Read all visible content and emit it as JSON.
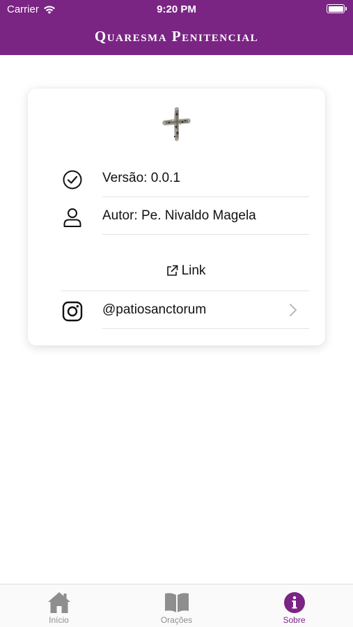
{
  "status_bar": {
    "carrier": "Carrier",
    "time": "9:20 PM"
  },
  "header": {
    "title": "Quaresma Penitencial"
  },
  "card": {
    "logo_icon": "ash-cross-logo",
    "version_text": "Versão: 0.0.1",
    "version_icon": "check-circle-icon",
    "author_text": "Autor: Pe. Nivaldo Magela",
    "author_icon": "person-icon",
    "link_label": "Link",
    "link_icon": "external-link-icon",
    "instagram_handle": "@patiosanctorum",
    "instagram_icon": "instagram-icon",
    "chevron_icon": "chevron-right-icon"
  },
  "tab_bar": {
    "tabs": [
      {
        "label": "Início",
        "icon": "home-icon",
        "active": false
      },
      {
        "label": "Orações",
        "icon": "book-icon",
        "active": false
      },
      {
        "label": "Sobre",
        "icon": "info-icon",
        "active": true
      }
    ]
  },
  "colors": {
    "brand": "#7a2484",
    "tab_inactive": "#8e8e8e",
    "divider": "#e3e3e3"
  }
}
